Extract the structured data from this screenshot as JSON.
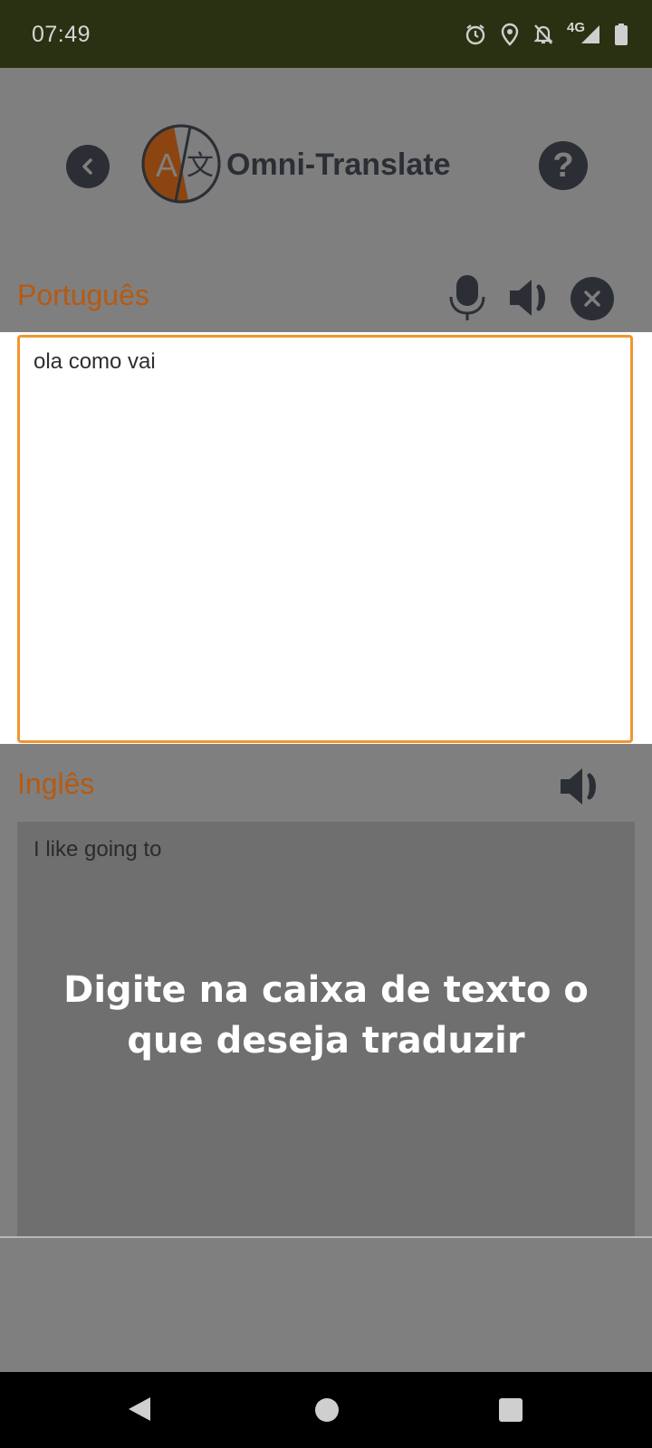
{
  "status_bar": {
    "time": "07:49",
    "network": "4G",
    "icons": [
      "alarm-icon",
      "location-icon",
      "notifications-off-icon",
      "signal-icon",
      "battery-icon"
    ]
  },
  "header": {
    "title": "Omni-Translate",
    "logo_icon": "translate-icon",
    "back_icon": "chevron-left-icon",
    "help_label": "?"
  },
  "source": {
    "language": "Português",
    "text": "ola como vai",
    "icons": [
      "microphone-icon",
      "speaker-icon",
      "close-icon"
    ]
  },
  "target": {
    "language": "Inglês",
    "text": "I like going to",
    "icons": [
      "speaker-icon"
    ]
  },
  "hint": "Digite na caixa de texto o que deseja traduzir",
  "colors": {
    "status_bar": "#2a3112",
    "overlay": "#7f7f7f",
    "accent_orange": "#f0962e",
    "label_orange": "#b65a12",
    "dark_icon": "#2b2f35"
  },
  "nav": {
    "icons": [
      "back-triangle-icon",
      "home-circle-icon",
      "recents-square-icon"
    ]
  }
}
